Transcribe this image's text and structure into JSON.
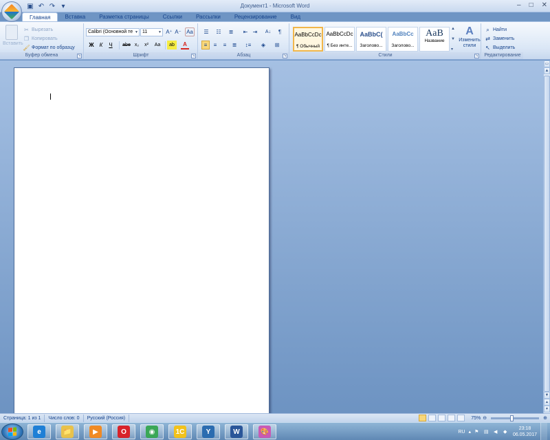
{
  "window": {
    "title": "Документ1 - Microsoft Word",
    "controls": {
      "minimize": "–",
      "maximize": "□",
      "close": "✕"
    }
  },
  "quick_access": [
    {
      "name": "save-icon",
      "glyph": "💾"
    },
    {
      "name": "undo-icon",
      "glyph": "↶"
    },
    {
      "name": "redo-icon",
      "glyph": "↷"
    },
    {
      "name": "customize-qat-icon",
      "glyph": "▾"
    }
  ],
  "tabs": [
    "Главная",
    "Вставка",
    "Разметка страницы",
    "Ссылки",
    "Рассылки",
    "Рецензирование",
    "Вид"
  ],
  "active_tab": "Главная",
  "ribbon": {
    "clipboard": {
      "label": "Буфер обмена",
      "paste": "Вставить",
      "cut": "Вырезать",
      "copy": "Копировать",
      "format_painter": "Формат по образцу"
    },
    "font": {
      "label": "Шрифт",
      "font_name": "Calibri (Основной те",
      "font_size": "11",
      "grow": "A⁺",
      "shrink": "A⁻",
      "clear": "Aa",
      "bold": "Ж",
      "italic": "К",
      "underline": "Ч",
      "strike": "abe",
      "subscript": "x₂",
      "superscript": "x²",
      "change_case": "Aa",
      "highlight": "ab",
      "font_color": "A"
    },
    "paragraph": {
      "label": "Абзац",
      "show_marks": "¶",
      "sort": "A↓"
    },
    "styles": {
      "label": "Стили",
      "items": [
        {
          "sample": "AaBbCcDc",
          "name": "¶ Обычный"
        },
        {
          "sample": "AaBbCcDc",
          "name": "¶ Без инте..."
        },
        {
          "sample": "AaBbC(",
          "name": "Заголово..."
        },
        {
          "sample": "AaBbCc",
          "name": "Заголово..."
        },
        {
          "sample": "AaB",
          "name": "Название"
        }
      ],
      "change_styles": "Изменить стили"
    },
    "editing": {
      "label": "Редактирование",
      "find": "Найти",
      "replace": "Заменить",
      "select": "Выделить"
    }
  },
  "status": {
    "page": "Страница: 1 из 1",
    "words": "Число слов: 0",
    "language": "Русский (Россия)",
    "zoom": "75%"
  },
  "taskbar": {
    "apps": [
      {
        "name": "internet-explorer",
        "glyph": "e",
        "color": "#1e7fd6"
      },
      {
        "name": "file-explorer",
        "glyph": "📁",
        "color": "#e8c24b"
      },
      {
        "name": "media-player",
        "glyph": "▶",
        "color": "#f08a24"
      },
      {
        "name": "opera",
        "glyph": "O",
        "color": "#d8232a"
      },
      {
        "name": "chrome",
        "glyph": "◉",
        "color": "#3aa757"
      },
      {
        "name": "1c",
        "glyph": "1С",
        "color": "#f2c21b"
      },
      {
        "name": "yandex",
        "glyph": "Y",
        "color": "#2b6cb0"
      },
      {
        "name": "word",
        "glyph": "W",
        "color": "#2a5699"
      },
      {
        "name": "paint",
        "glyph": "🎨",
        "color": "#c85ab5"
      }
    ],
    "lang": "RU",
    "time": "23:18",
    "date": "06.05.2017"
  }
}
